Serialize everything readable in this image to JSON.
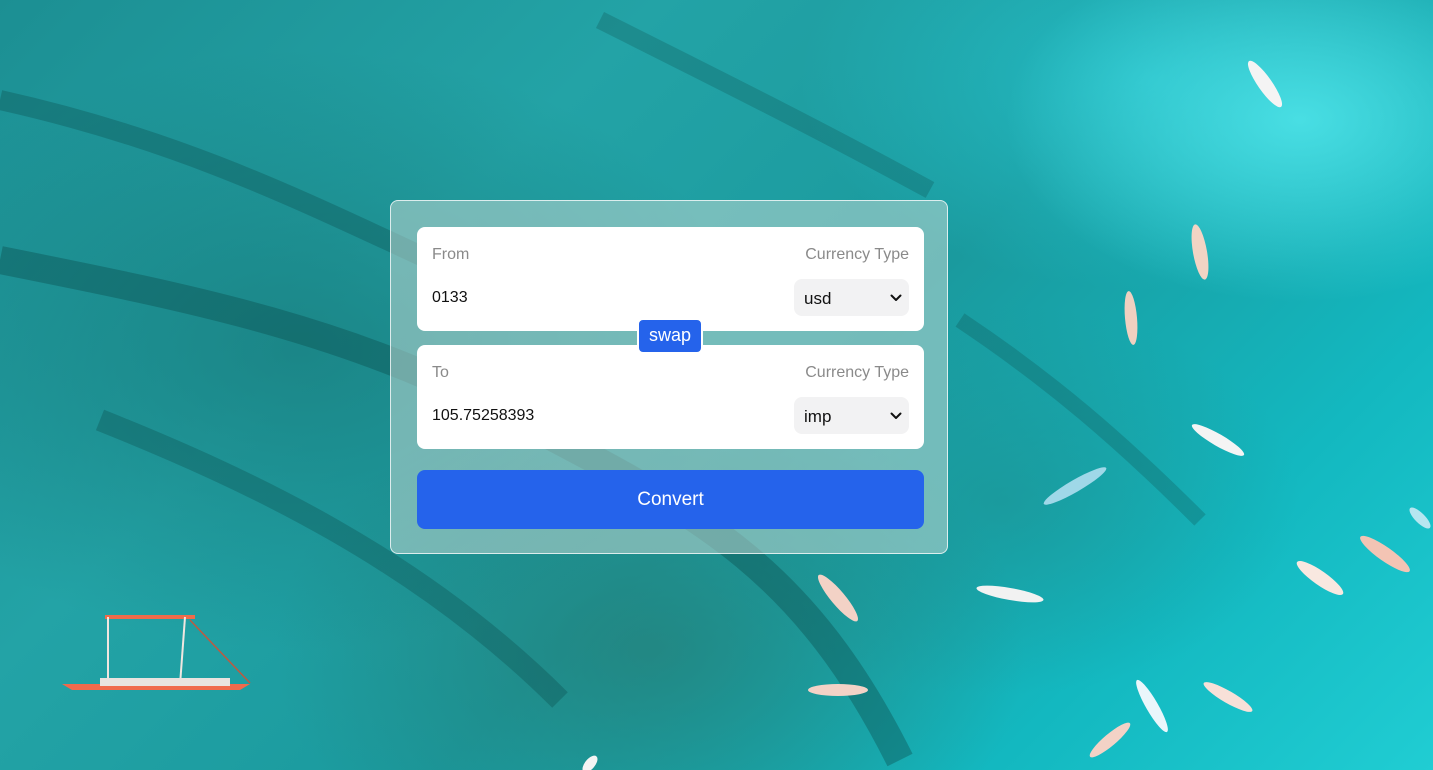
{
  "converter": {
    "from": {
      "label": "From",
      "type_label": "Currency Type",
      "amount": "0133",
      "currency": "usd"
    },
    "to": {
      "label": "To",
      "type_label": "Currency Type",
      "amount": "105.75258393",
      "currency": "imp"
    },
    "swap_label": "swap",
    "convert_label": "Convert"
  },
  "icons": {
    "select_arrow": "chevron-down-icon"
  },
  "colors": {
    "accent": "#2563eb",
    "card_border": "#ffffff",
    "field_bg": "#ffffff",
    "select_bg": "#f2f2f3",
    "label_text": "#8a8a8a"
  },
  "background": {
    "description_image": "aerial-ocean-surfers"
  }
}
